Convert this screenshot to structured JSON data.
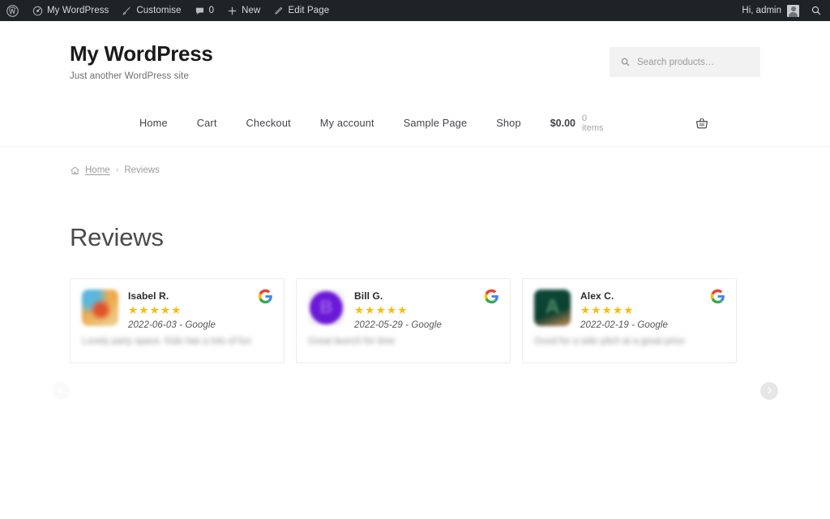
{
  "adminbar": {
    "logo_icon": "wordpress-logo-icon",
    "items": [
      {
        "icon": "dashboard-icon",
        "label": "My WordPress"
      },
      {
        "icon": "paintbrush-icon",
        "label": "Customise"
      },
      {
        "icon": "comment-icon",
        "label": "0"
      },
      {
        "icon": "plus-icon",
        "label": "New"
      },
      {
        "icon": "pencil-icon",
        "label": "Edit Page"
      }
    ],
    "howdy": "Hi, admin",
    "search_icon": "search-icon"
  },
  "header": {
    "site_title": "My WordPress",
    "tagline": "Just another WordPress site",
    "search": {
      "placeholder": "Search products…",
      "value": "",
      "icon": "search-icon"
    }
  },
  "nav": {
    "items": [
      {
        "label": "Home"
      },
      {
        "label": "Cart"
      },
      {
        "label": "Checkout"
      },
      {
        "label": "My account"
      },
      {
        "label": "Sample Page"
      },
      {
        "label": "Shop"
      }
    ],
    "cart": {
      "amount": "$0.00",
      "count": "0 items",
      "icon": "shopping-basket-icon"
    }
  },
  "breadcrumb": {
    "home_icon": "home-icon",
    "home_label": "Home",
    "separator": "›",
    "current": "Reviews"
  },
  "page": {
    "title": "Reviews"
  },
  "carousel": {
    "prev_icon": "chevron-left-icon",
    "next_icon": "chevron-right-icon",
    "reviews": [
      {
        "name": "Isabel R.",
        "stars": "★★★★★",
        "rating": 5,
        "date_source": "2022-06-03 - Google",
        "body": "Lovely party space. Kids has a lots of fun",
        "source_icon": "google-logo-icon",
        "avatar": "photo-avatar"
      },
      {
        "name": "Bill G.",
        "stars": "★★★★★",
        "rating": 5,
        "date_source": "2022-05-29 - Google",
        "body": "Great launch for time",
        "source_icon": "google-logo-icon",
        "avatar": "initial-avatar-b"
      },
      {
        "name": "Alex C.",
        "stars": "★★★★★",
        "rating": 5,
        "date_source": "2022-02-19 - Google",
        "body": "Good for a side pitch at a great price",
        "source_icon": "google-logo-icon",
        "avatar": "initial-avatar-a"
      }
    ]
  },
  "colors": {
    "adminbar_bg": "#1d2327",
    "star": "#fbbc0b",
    "text": "#43454b",
    "muted": "#9b9b9b",
    "card_border": "#ececec"
  }
}
